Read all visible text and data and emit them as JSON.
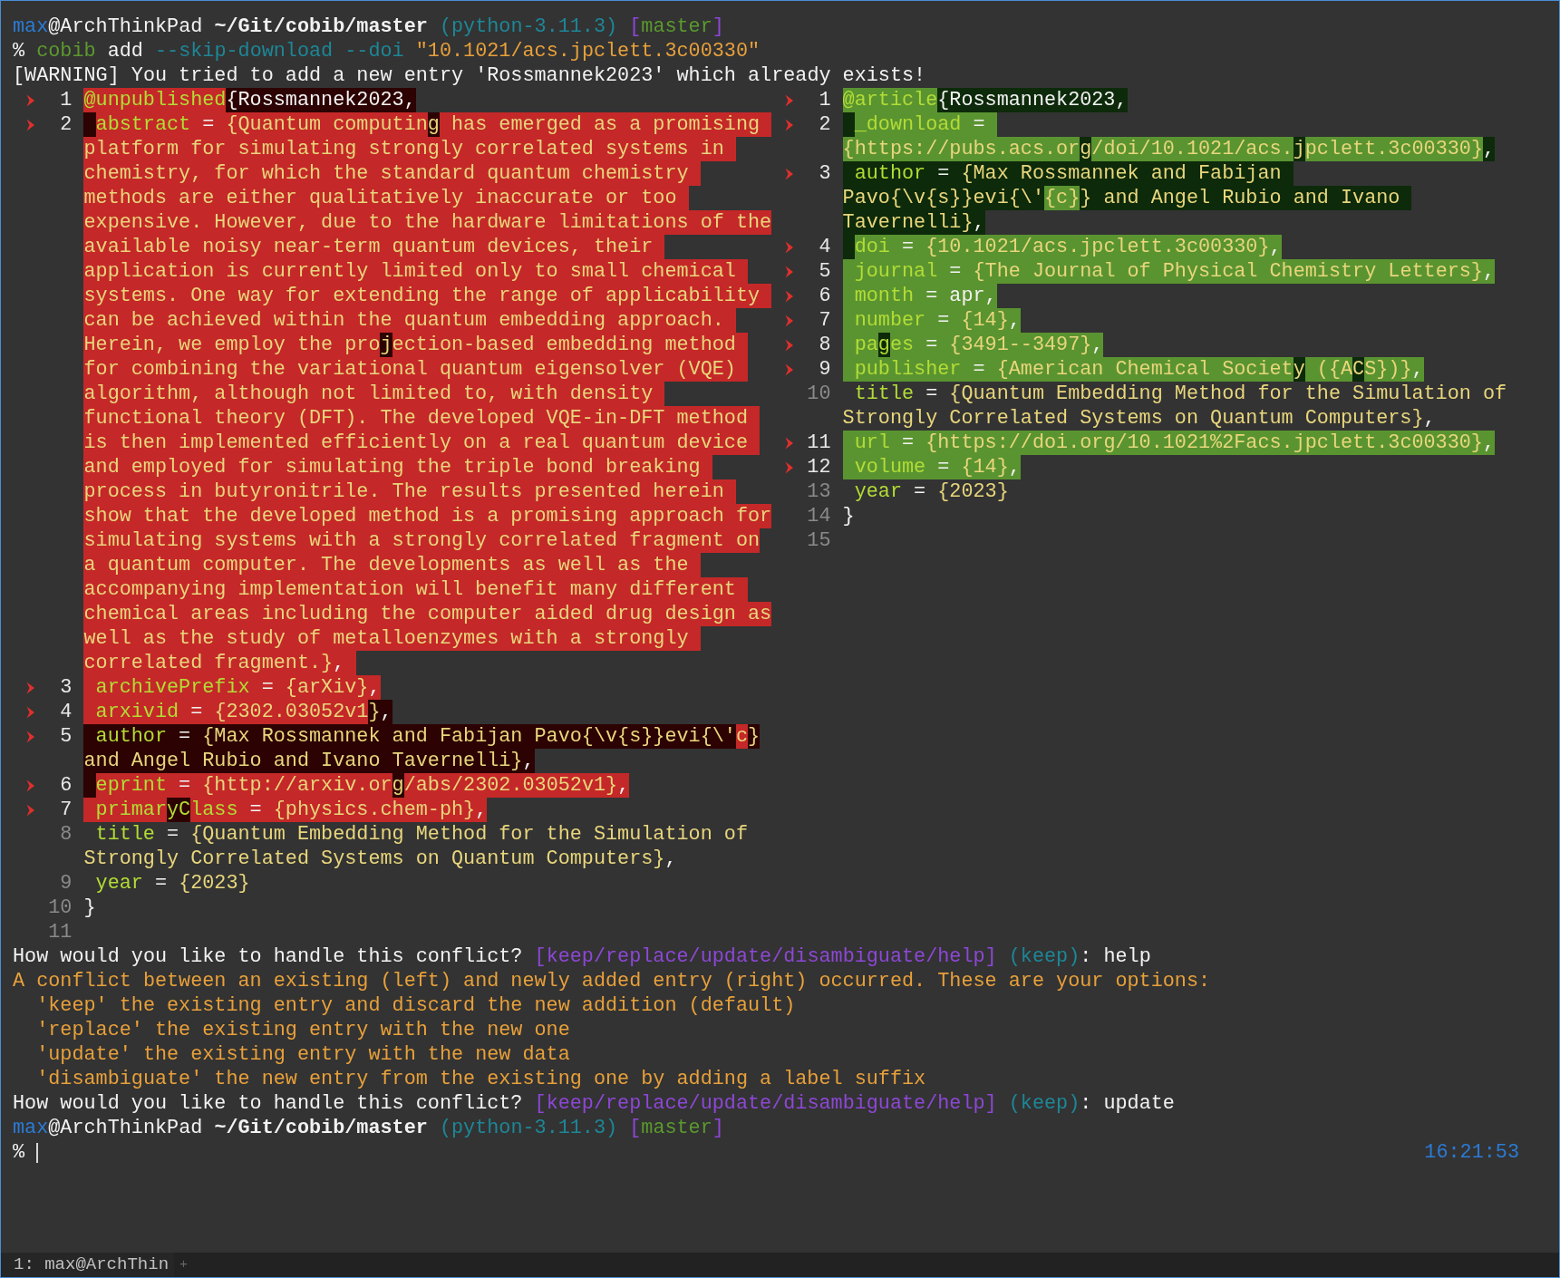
{
  "terminal": {
    "lines_before": [
      {
        "segments": [
          {
            "t": "max",
            "kind": "user"
          },
          {
            "t": "@ArchThinkPad ",
            "kind": "plain"
          },
          {
            "t": "~/Git/cobib/master",
            "kind": "path"
          },
          {
            "t": " (python-3.11.3)",
            "kind": "teal"
          },
          {
            "t": " [",
            "kind": "purple"
          },
          {
            "t": "master",
            "kind": "green"
          },
          {
            "t": "]",
            "kind": "purple"
          }
        ]
      },
      {
        "segments": [
          {
            "t": "% ",
            "kind": "plain"
          },
          {
            "t": "cobib",
            "kind": "green"
          },
          {
            "t": " add ",
            "kind": "plain"
          },
          {
            "t": "--skip-download --doi",
            "kind": "teal"
          },
          {
            "t": " \"10.1021/acs.jpclett.3c00330\"",
            "kind": "orange"
          }
        ]
      },
      {
        "segments": [
          {
            "t": "[WARNING] You tried to add a new entry 'Rossmannek2023' which already exists!",
            "kind": "plain"
          }
        ]
      }
    ],
    "diff": {
      "left": [
        {
          "changed": true,
          "number": "1",
          "rows": [
            {
              "segments": [
                {
                  "t": "@unpublished",
                  "kind": "key",
                  "changed": true
                },
                {
                  "t": "{Rossmannek2023,",
                  "kind": "plain",
                  "changed": false
                }
              ]
            }
          ]
        },
        {
          "changed": true,
          "number": "2",
          "indent_changed": false,
          "rows": [
            {
              "segments": [
                {
                  "t": "abstract",
                  "kind": "key",
                  "changed": true
                },
                {
                  "t": " = ",
                  "kind": "plain",
                  "changed": true
                },
                {
                  "t": "{Quantum computin",
                  "kind": "val",
                  "changed": true
                },
                {
                  "t": "g",
                  "kind": "val",
                  "changed": false
                },
                {
                  "t": " has emerged as a promising ",
                  "kind": "val",
                  "changed": true
                }
              ]
            },
            {
              "segments": [
                {
                  "t": "platform for simulating strongly correlated systems in ",
                  "kind": "val",
                  "changed": true
                }
              ]
            },
            {
              "segments": [
                {
                  "t": "chemistry, for which the standard quantum chemistry ",
                  "kind": "val",
                  "changed": true
                }
              ]
            },
            {
              "segments": [
                {
                  "t": "methods are either qualitatively inaccurate or too ",
                  "kind": "val",
                  "changed": true
                }
              ]
            },
            {
              "segments": [
                {
                  "t": "expensive. However, due to the hardware limitations of the",
                  "kind": "val",
                  "changed": true
                }
              ]
            },
            {
              "segments": [
                {
                  "t": "available noisy near-term quantum devices, their ",
                  "kind": "val",
                  "changed": true
                }
              ]
            },
            {
              "segments": [
                {
                  "t": "application is currently limited only to small chemical ",
                  "kind": "val",
                  "changed": true
                }
              ]
            },
            {
              "segments": [
                {
                  "t": "systems. One way for extending the range of applicability ",
                  "kind": "val",
                  "changed": true
                }
              ]
            },
            {
              "segments": [
                {
                  "t": "can be achieved within the quantum embedding approach. ",
                  "kind": "val",
                  "changed": true
                }
              ]
            },
            {
              "segments": [
                {
                  "t": "Herein, we employ the pro",
                  "kind": "val",
                  "changed": true
                },
                {
                  "t": "j",
                  "kind": "val",
                  "changed": false
                },
                {
                  "t": "ection-based embedding method ",
                  "kind": "val",
                  "changed": true
                }
              ]
            },
            {
              "segments": [
                {
                  "t": "for combining the variational quantum eigensolver (VQE) ",
                  "kind": "val",
                  "changed": true
                }
              ]
            },
            {
              "segments": [
                {
                  "t": "algorithm, although not limited to, with density ",
                  "kind": "val",
                  "changed": true
                }
              ]
            },
            {
              "segments": [
                {
                  "t": "functional theory (DFT). The developed VQE-in-DFT method ",
                  "kind": "val",
                  "changed": true
                }
              ]
            },
            {
              "segments": [
                {
                  "t": "is then implemented efficiently on a real quantum device ",
                  "kind": "val",
                  "changed": true
                }
              ]
            },
            {
              "segments": [
                {
                  "t": "and employed for simulating the triple bond breaking ",
                  "kind": "val",
                  "changed": true
                }
              ]
            },
            {
              "segments": [
                {
                  "t": "process in butyronitrile. The results presented herein ",
                  "kind": "val",
                  "changed": true
                }
              ]
            },
            {
              "segments": [
                {
                  "t": "show that the developed method is a promising approach for",
                  "kind": "val",
                  "changed": true
                }
              ]
            },
            {
              "segments": [
                {
                  "t": "simulating systems with a strongly correlated fragment on",
                  "kind": "val",
                  "changed": true
                }
              ]
            },
            {
              "segments": [
                {
                  "t": "a quantum computer. The developments as well as the ",
                  "kind": "val",
                  "changed": true
                }
              ]
            },
            {
              "segments": [
                {
                  "t": "accompanying implementation will benefit many different ",
                  "kind": "val",
                  "changed": true
                }
              ]
            },
            {
              "segments": [
                {
                  "t": "chemical areas including the computer aided drug design as",
                  "kind": "val",
                  "changed": true
                }
              ]
            },
            {
              "segments": [
                {
                  "t": "well as the study of metalloenzymes with a strongly ",
                  "kind": "val",
                  "changed": true
                }
              ]
            },
            {
              "segments": [
                {
                  "t": "correlated fragment.}",
                  "kind": "val",
                  "changed": true
                },
                {
                  "t": ", ",
                  "kind": "plain",
                  "changed": true
                }
              ]
            }
          ]
        },
        {
          "changed": true,
          "number": "3",
          "rows": [
            {
              "segments": [
                {
                  "t": " archivePrefix",
                  "kind": "key",
                  "changed": true
                },
                {
                  "t": " = ",
                  "kind": "plain",
                  "changed": true
                },
                {
                  "t": "{arXiv}",
                  "kind": "val",
                  "changed": true
                },
                {
                  "t": ",",
                  "kind": "plain",
                  "changed": true
                }
              ]
            }
          ]
        },
        {
          "changed": true,
          "number": "4",
          "rows": [
            {
              "segments": [
                {
                  "t": " arxivid",
                  "kind": "key",
                  "changed": true
                },
                {
                  "t": " = ",
                  "kind": "plain",
                  "changed": true
                },
                {
                  "t": "{2302.03052v1",
                  "kind": "val",
                  "changed": true
                },
                {
                  "t": "}",
                  "kind": "val",
                  "changed": false
                },
                {
                  "t": ",",
                  "kind": "plain",
                  "changed": false
                }
              ]
            }
          ]
        },
        {
          "changed": true,
          "number": "5",
          "rows": [
            {
              "segments": [
                {
                  "t": " author",
                  "kind": "key",
                  "changed": false
                },
                {
                  "t": " = ",
                  "kind": "plain",
                  "changed": false
                },
                {
                  "t": "{Max Rossmannek and Fabijan Pavo{\\v{s}}evi{\\'",
                  "kind": "val",
                  "changed": false
                },
                {
                  "t": "c",
                  "kind": "val",
                  "changed": true
                },
                {
                  "t": "}",
                  "kind": "val",
                  "changed": false
                }
              ]
            },
            {
              "segments": [
                {
                  "t": "and Angel Rubio and Ivano Tavernelli}",
                  "kind": "val",
                  "changed": false
                },
                {
                  "t": ",",
                  "kind": "plain",
                  "changed": false
                }
              ]
            }
          ]
        },
        {
          "changed": true,
          "number": "6",
          "indent_changed": false,
          "rows": [
            {
              "segments": [
                {
                  "t": "eprint",
                  "kind": "key",
                  "changed": true
                },
                {
                  "t": " = ",
                  "kind": "plain",
                  "changed": true
                },
                {
                  "t": "{http://arxiv.or",
                  "kind": "val",
                  "changed": true
                },
                {
                  "t": "g",
                  "kind": "val",
                  "changed": false
                },
                {
                  "t": "/abs/2302.03052v1}",
                  "kind": "val",
                  "changed": true
                },
                {
                  "t": ",",
                  "kind": "plain",
                  "changed": true
                }
              ]
            }
          ]
        },
        {
          "changed": true,
          "number": "7",
          "rows": [
            {
              "segments": [
                {
                  "t": " primar",
                  "kind": "key",
                  "changed": true
                },
                {
                  "t": "yC",
                  "kind": "key",
                  "changed": false
                },
                {
                  "t": "lass",
                  "kind": "key",
                  "changed": true
                },
                {
                  "t": " = ",
                  "kind": "plain",
                  "changed": true
                },
                {
                  "t": "{physics.chem-ph}",
                  "kind": "val",
                  "changed": true
                },
                {
                  "t": ",",
                  "kind": "plain",
                  "changed": true
                }
              ]
            }
          ]
        },
        {
          "changed": false,
          "number": "8",
          "rows": [
            {
              "segments": [
                {
                  "t": " title",
                  "kind": "key"
                },
                {
                  "t": " = ",
                  "kind": "plain"
                },
                {
                  "t": "{Quantum Embedding Method for the Simulation of",
                  "kind": "val"
                }
              ]
            },
            {
              "segments": [
                {
                  "t": "Strongly Correlated Systems on Quantum Computers}",
                  "kind": "val"
                },
                {
                  "t": ",",
                  "kind": "plain"
                }
              ]
            }
          ]
        },
        {
          "changed": false,
          "number": "9",
          "rows": [
            {
              "segments": [
                {
                  "t": " year",
                  "kind": "key"
                },
                {
                  "t": " = ",
                  "kind": "plain"
                },
                {
                  "t": "{2023}",
                  "kind": "val"
                }
              ]
            }
          ]
        },
        {
          "changed": false,
          "number": "10",
          "rows": [
            {
              "segments": [
                {
                  "t": "}",
                  "kind": "plain"
                }
              ]
            }
          ]
        },
        {
          "changed": false,
          "number": "11"
        }
      ],
      "right": [
        {
          "changed": true,
          "number": "1",
          "rows": [
            {
              "segments": [
                {
                  "t": "@article",
                  "kind": "key",
                  "changed": true
                },
                {
                  "t": "{Rossmannek2023,",
                  "kind": "plain",
                  "changed": false
                }
              ]
            }
          ]
        },
        {
          "changed": true,
          "number": "2",
          "indent_changed": false,
          "rows": [
            {
              "segments": [
                {
                  "t": "_download",
                  "kind": "key",
                  "changed": true
                },
                {
                  "t": " = ",
                  "kind": "plain",
                  "changed": true
                }
              ]
            },
            {
              "segments": [
                {
                  "t": "{https://pubs.acs.or",
                  "kind": "val",
                  "changed": true
                },
                {
                  "t": "g",
                  "kind": "val",
                  "changed": false
                },
                {
                  "t": "/doi/10.1021/acs.",
                  "kind": "val",
                  "changed": true
                },
                {
                  "t": "j",
                  "kind": "val",
                  "changed": false
                },
                {
                  "t": "pclett.3c00330}",
                  "kind": "val",
                  "changed": true
                },
                {
                  "t": ",",
                  "kind": "plain",
                  "changed": false
                }
              ]
            }
          ]
        },
        {
          "changed": true,
          "number": "3",
          "rows": [
            {
              "segments": [
                {
                  "t": " author",
                  "kind": "key",
                  "changed": false
                },
                {
                  "t": " = ",
                  "kind": "plain",
                  "changed": false
                },
                {
                  "t": "{Max Rossmannek and Fabijan ",
                  "kind": "val",
                  "changed": false
                }
              ]
            },
            {
              "segments": [
                {
                  "t": "Pavo{\\v{s}}evi{\\'",
                  "kind": "val",
                  "changed": false
                },
                {
                  "t": "{c}",
                  "kind": "val",
                  "changed": true
                },
                {
                  "t": "} and Angel Rubio and Ivano ",
                  "kind": "val",
                  "changed": false
                }
              ]
            },
            {
              "segments": [
                {
                  "t": "Tavernelli}",
                  "kind": "val",
                  "changed": false
                },
                {
                  "t": ",",
                  "kind": "plain",
                  "changed": false
                }
              ]
            }
          ]
        },
        {
          "changed": true,
          "number": "4",
          "indent_changed": false,
          "rows": [
            {
              "segments": [
                {
                  "t": "doi",
                  "kind": "key",
                  "changed": true
                },
                {
                  "t": " = ",
                  "kind": "plain",
                  "changed": true
                },
                {
                  "t": "{10.1021/acs.jpclett.3c00330}",
                  "kind": "val",
                  "changed": true
                },
                {
                  "t": ",",
                  "kind": "plain",
                  "changed": true
                }
              ]
            }
          ]
        },
        {
          "changed": true,
          "number": "5",
          "rows": [
            {
              "segments": [
                {
                  "t": " journal",
                  "kind": "key",
                  "changed": true
                },
                {
                  "t": " = ",
                  "kind": "plain",
                  "changed": true
                },
                {
                  "t": "{The Journal of Physical Chemistry Letters}",
                  "kind": "val",
                  "changed": true
                },
                {
                  "t": ",",
                  "kind": "plain",
                  "changed": true
                }
              ]
            }
          ]
        },
        {
          "changed": true,
          "number": "6",
          "rows": [
            {
              "segments": [
                {
                  "t": " month",
                  "kind": "key",
                  "changed": true
                },
                {
                  "t": " = ",
                  "kind": "plain",
                  "changed": true
                },
                {
                  "t": "apr",
                  "kind": "plain",
                  "changed": true
                },
                {
                  "t": ",",
                  "kind": "plain",
                  "changed": true
                }
              ]
            }
          ]
        },
        {
          "changed": true,
          "number": "7",
          "rows": [
            {
              "segments": [
                {
                  "t": " number",
                  "kind": "key",
                  "changed": true
                },
                {
                  "t": " = ",
                  "kind": "plain",
                  "changed": true
                },
                {
                  "t": "{14}",
                  "kind": "val",
                  "changed": true
                },
                {
                  "t": ",",
                  "kind": "plain",
                  "changed": true
                }
              ]
            }
          ]
        },
        {
          "changed": true,
          "number": "8",
          "rows": [
            {
              "segments": [
                {
                  "t": " pa",
                  "kind": "key",
                  "changed": true
                },
                {
                  "t": "g",
                  "kind": "key",
                  "changed": false
                },
                {
                  "t": "es",
                  "kind": "key",
                  "changed": true
                },
                {
                  "t": " = ",
                  "kind": "plain",
                  "changed": true
                },
                {
                  "t": "{3491--3497}",
                  "kind": "val",
                  "changed": true
                },
                {
                  "t": ",",
                  "kind": "plain",
                  "changed": true
                }
              ]
            }
          ]
        },
        {
          "changed": true,
          "number": "9",
          "rows": [
            {
              "segments": [
                {
                  "t": " publisher",
                  "kind": "key",
                  "changed": true
                },
                {
                  "t": " = ",
                  "kind": "plain",
                  "changed": true
                },
                {
                  "t": "{American Chemical Societ",
                  "kind": "val",
                  "changed": true
                },
                {
                  "t": "y",
                  "kind": "val",
                  "changed": false
                },
                {
                  "t": " ({A",
                  "kind": "val",
                  "changed": true
                },
                {
                  "t": "C",
                  "kind": "val",
                  "changed": false
                },
                {
                  "t": "S})}",
                  "kind": "val",
                  "changed": true
                },
                {
                  "t": ",",
                  "kind": "plain",
                  "changed": true
                }
              ]
            }
          ]
        },
        {
          "changed": false,
          "number": "10",
          "rows": [
            {
              "segments": [
                {
                  "t": " title",
                  "kind": "key"
                },
                {
                  "t": " = ",
                  "kind": "plain"
                },
                {
                  "t": "{Quantum Embedding Method for the Simulation of",
                  "kind": "val"
                }
              ]
            },
            {
              "segments": [
                {
                  "t": "Strongly Correlated Systems on Quantum Computers}",
                  "kind": "val"
                },
                {
                  "t": ",",
                  "kind": "plain"
                }
              ]
            }
          ]
        },
        {
          "changed": true,
          "number": "11",
          "rows": [
            {
              "segments": [
                {
                  "t": " url",
                  "kind": "key",
                  "changed": true
                },
                {
                  "t": " = ",
                  "kind": "plain",
                  "changed": true
                },
                {
                  "t": "{https://doi.org/10.1021%2Facs.jpclett.3c00330}",
                  "kind": "val",
                  "changed": true
                },
                {
                  "t": ",",
                  "kind": "plain",
                  "changed": true
                }
              ]
            }
          ]
        },
        {
          "changed": true,
          "number": "12",
          "rows": [
            {
              "segments": [
                {
                  "t": " volume",
                  "kind": "key",
                  "changed": true
                },
                {
                  "t": " = ",
                  "kind": "plain",
                  "changed": true
                },
                {
                  "t": "{14}",
                  "kind": "val",
                  "changed": true
                },
                {
                  "t": ",",
                  "kind": "plain",
                  "changed": true
                }
              ]
            }
          ]
        },
        {
          "changed": false,
          "number": "13",
          "rows": [
            {
              "segments": [
                {
                  "t": " year",
                  "kind": "key"
                },
                {
                  "t": " = ",
                  "kind": "plain"
                },
                {
                  "t": "{2023}",
                  "kind": "val"
                }
              ]
            }
          ]
        },
        {
          "changed": false,
          "number": "14",
          "rows": [
            {
              "segments": [
                {
                  "t": "}",
                  "kind": "plain"
                }
              ]
            }
          ]
        },
        {
          "changed": false,
          "number": "15"
        }
      ]
    },
    "lines_after": [
      {
        "segments": [
          {
            "t": "How would you like to handle this conflict? ",
            "kind": "plain"
          },
          {
            "t": "[keep/replace/update/disambiguate/help]",
            "kind": "purple"
          },
          {
            "t": " (keep)",
            "kind": "teal"
          },
          {
            "t": ": help",
            "kind": "plain"
          }
        ]
      },
      {
        "indent": false,
        "segments": [
          {
            "t": "A conflict between an existing (left) and newly added entry (right) occurred. These are your options:",
            "kind": "orange"
          }
        ]
      },
      {
        "indent": true,
        "segments": [
          {
            "t": "'keep' the existing entry and discard the new addition (default)",
            "kind": "orange"
          }
        ]
      },
      {
        "indent": true,
        "segments": [
          {
            "t": "'replace' the existing entry with the new one",
            "kind": "orange"
          }
        ]
      },
      {
        "indent": true,
        "segments": [
          {
            "t": "'update' the existing entry with the new data",
            "kind": "orange"
          }
        ]
      },
      {
        "indent": true,
        "segments": [
          {
            "t": "'disambiguate' the new entry from the existing one by adding a label suffix",
            "kind": "orange"
          }
        ]
      },
      {
        "segments": [
          {
            "t": "How would you like to handle this conflict? ",
            "kind": "plain"
          },
          {
            "t": "[keep/replace/update/disambiguate/help]",
            "kind": "purple"
          },
          {
            "t": " (keep)",
            "kind": "teal"
          },
          {
            "t": ": update",
            "kind": "plain"
          }
        ]
      },
      {
        "segments": [
          {
            "t": "max",
            "kind": "user"
          },
          {
            "t": "@ArchThinkPad ",
            "kind": "plain"
          },
          {
            "t": "~/Git/cobib/master",
            "kind": "path"
          },
          {
            "t": " (python-3.11.3)",
            "kind": "teal"
          },
          {
            "t": " [",
            "kind": "purple"
          },
          {
            "t": "master",
            "kind": "green"
          },
          {
            "t": "]",
            "kind": "purple"
          }
        ]
      }
    ],
    "prompt": {
      "symbol": "%",
      "clock": "16:21:53"
    }
  },
  "tab_bar": {
    "tabs": [
      {
        "label": "1: max@ArchThin",
        "selected": true
      }
    ],
    "new_tab": "+"
  }
}
